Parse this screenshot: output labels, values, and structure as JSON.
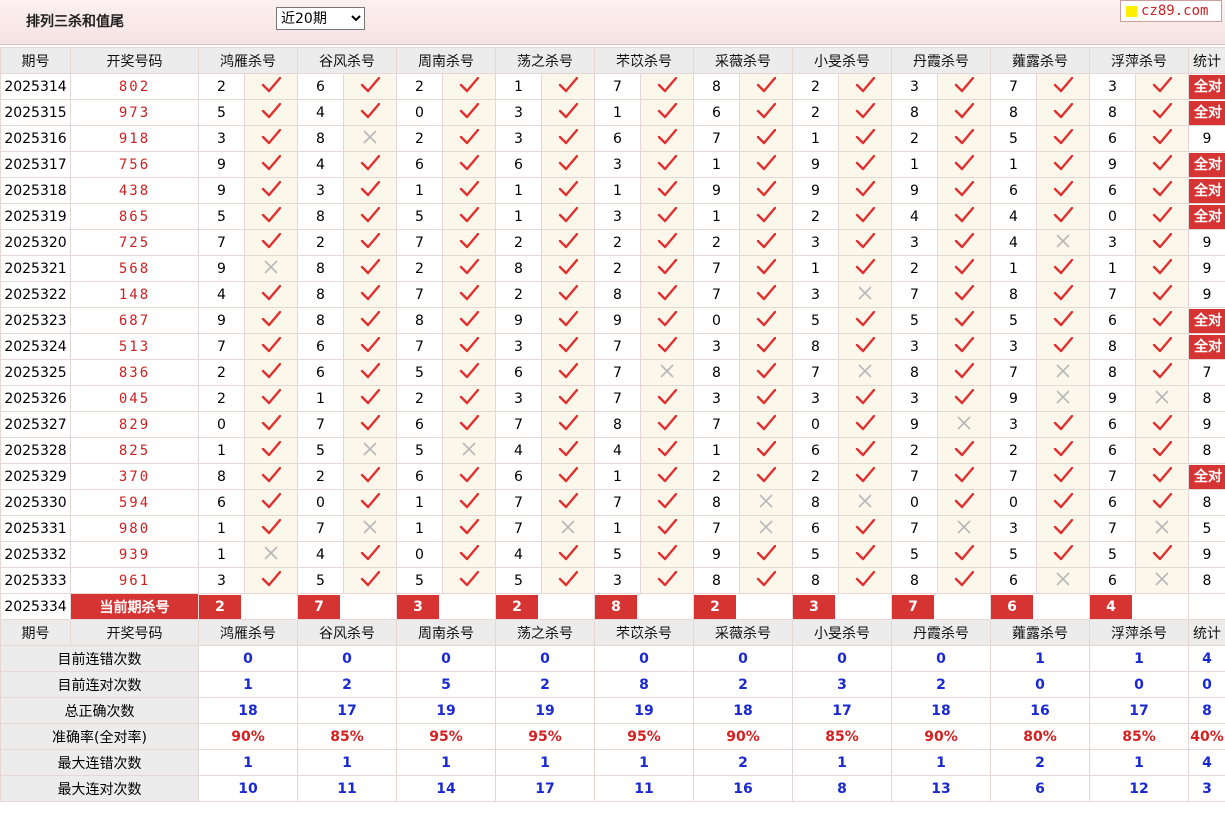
{
  "header": {
    "title": "排列三杀和值尾",
    "period_select": "近20期",
    "logo_text": "cz89.com"
  },
  "columns": {
    "issue": "期号",
    "draw": "开奖号码",
    "experts": [
      "鸿雁杀号",
      "谷风杀号",
      "周南杀号",
      "荡之杀号",
      "芣苡杀号",
      "采薇杀号",
      "小旻杀号",
      "丹霞杀号",
      "蕹露杀号",
      "浮萍杀号"
    ],
    "stat": "统计"
  },
  "rows": [
    {
      "issue": "2025314",
      "draw": "802",
      "kills": [
        2,
        6,
        2,
        1,
        7,
        8,
        2,
        3,
        7,
        3
      ],
      "ok": [
        1,
        1,
        1,
        1,
        1,
        1,
        1,
        1,
        1,
        1
      ],
      "stat": "全对"
    },
    {
      "issue": "2025315",
      "draw": "973",
      "kills": [
        5,
        4,
        0,
        3,
        1,
        6,
        2,
        8,
        8,
        8
      ],
      "ok": [
        1,
        1,
        1,
        1,
        1,
        1,
        1,
        1,
        1,
        1
      ],
      "stat": "全对"
    },
    {
      "issue": "2025316",
      "draw": "918",
      "kills": [
        3,
        8,
        2,
        3,
        6,
        7,
        1,
        2,
        5,
        6
      ],
      "ok": [
        1,
        0,
        1,
        1,
        1,
        1,
        1,
        1,
        1,
        1
      ],
      "stat": "9"
    },
    {
      "issue": "2025317",
      "draw": "756",
      "kills": [
        9,
        4,
        6,
        6,
        3,
        1,
        9,
        1,
        1,
        9
      ],
      "ok": [
        1,
        1,
        1,
        1,
        1,
        1,
        1,
        1,
        1,
        1
      ],
      "stat": "全对"
    },
    {
      "issue": "2025318",
      "draw": "438",
      "kills": [
        9,
        3,
        1,
        1,
        1,
        9,
        9,
        9,
        6,
        6
      ],
      "ok": [
        1,
        1,
        1,
        1,
        1,
        1,
        1,
        1,
        1,
        1
      ],
      "stat": "全对"
    },
    {
      "issue": "2025319",
      "draw": "865",
      "kills": [
        5,
        8,
        5,
        1,
        3,
        1,
        2,
        4,
        4,
        0
      ],
      "ok": [
        1,
        1,
        1,
        1,
        1,
        1,
        1,
        1,
        1,
        1
      ],
      "stat": "全对"
    },
    {
      "issue": "2025320",
      "draw": "725",
      "kills": [
        7,
        2,
        7,
        2,
        2,
        2,
        3,
        3,
        4,
        3
      ],
      "ok": [
        1,
        1,
        1,
        1,
        1,
        1,
        1,
        1,
        0,
        1
      ],
      "stat": "9"
    },
    {
      "issue": "2025321",
      "draw": "568",
      "kills": [
        9,
        8,
        2,
        8,
        2,
        7,
        1,
        2,
        1,
        1
      ],
      "ok": [
        0,
        1,
        1,
        1,
        1,
        1,
        1,
        1,
        1,
        1
      ],
      "stat": "9"
    },
    {
      "issue": "2025322",
      "draw": "148",
      "kills": [
        4,
        8,
        7,
        2,
        8,
        7,
        3,
        7,
        8,
        7
      ],
      "ok": [
        1,
        1,
        1,
        1,
        1,
        1,
        0,
        1,
        1,
        1
      ],
      "stat": "9"
    },
    {
      "issue": "2025323",
      "draw": "687",
      "kills": [
        9,
        8,
        8,
        9,
        9,
        0,
        5,
        5,
        5,
        6
      ],
      "ok": [
        1,
        1,
        1,
        1,
        1,
        1,
        1,
        1,
        1,
        1
      ],
      "stat": "全对"
    },
    {
      "issue": "2025324",
      "draw": "513",
      "kills": [
        7,
        6,
        7,
        3,
        7,
        3,
        8,
        3,
        3,
        8
      ],
      "ok": [
        1,
        1,
        1,
        1,
        1,
        1,
        1,
        1,
        1,
        1
      ],
      "stat": "全对"
    },
    {
      "issue": "2025325",
      "draw": "836",
      "kills": [
        2,
        6,
        5,
        6,
        7,
        8,
        7,
        8,
        7,
        8
      ],
      "ok": [
        1,
        1,
        1,
        1,
        0,
        1,
        0,
        1,
        0,
        1
      ],
      "stat": "7"
    },
    {
      "issue": "2025326",
      "draw": "045",
      "kills": [
        2,
        1,
        2,
        3,
        7,
        3,
        3,
        3,
        9,
        9
      ],
      "ok": [
        1,
        1,
        1,
        1,
        1,
        1,
        1,
        1,
        0,
        0
      ],
      "stat": "8"
    },
    {
      "issue": "2025327",
      "draw": "829",
      "kills": [
        0,
        7,
        6,
        7,
        8,
        7,
        0,
        9,
        3,
        6
      ],
      "ok": [
        1,
        1,
        1,
        1,
        1,
        1,
        1,
        0,
        1,
        1
      ],
      "stat": "9"
    },
    {
      "issue": "2025328",
      "draw": "825",
      "kills": [
        1,
        5,
        5,
        4,
        4,
        1,
        6,
        2,
        2,
        6
      ],
      "ok": [
        1,
        0,
        0,
        1,
        1,
        1,
        1,
        1,
        1,
        1
      ],
      "stat": "8"
    },
    {
      "issue": "2025329",
      "draw": "370",
      "kills": [
        8,
        2,
        6,
        6,
        1,
        2,
        2,
        7,
        7,
        7
      ],
      "ok": [
        1,
        1,
        1,
        1,
        1,
        1,
        1,
        1,
        1,
        1
      ],
      "stat": "全对"
    },
    {
      "issue": "2025330",
      "draw": "594",
      "kills": [
        6,
        0,
        1,
        7,
        7,
        8,
        8,
        0,
        0,
        6
      ],
      "ok": [
        1,
        1,
        1,
        1,
        1,
        0,
        0,
        1,
        1,
        1
      ],
      "stat": "8"
    },
    {
      "issue": "2025331",
      "draw": "980",
      "kills": [
        1,
        7,
        1,
        7,
        1,
        7,
        6,
        7,
        3,
        7
      ],
      "ok": [
        1,
        0,
        1,
        0,
        1,
        0,
        1,
        0,
        1,
        0
      ],
      "stat": "5"
    },
    {
      "issue": "2025332",
      "draw": "939",
      "kills": [
        1,
        4,
        0,
        4,
        5,
        9,
        5,
        5,
        5,
        5
      ],
      "ok": [
        0,
        1,
        1,
        1,
        1,
        1,
        1,
        1,
        1,
        1
      ],
      "stat": "9"
    },
    {
      "issue": "2025333",
      "draw": "961",
      "kills": [
        3,
        5,
        5,
        5,
        3,
        8,
        8,
        8,
        6,
        6
      ],
      "ok": [
        1,
        1,
        1,
        1,
        1,
        1,
        1,
        1,
        0,
        0
      ],
      "stat": "8"
    }
  ],
  "current": {
    "issue": "2025334",
    "label": "当前期杀号",
    "kills": [
      2,
      7,
      3,
      2,
      8,
      2,
      3,
      7,
      6,
      4
    ]
  },
  "summary": [
    {
      "label": "目前连错次数",
      "values": [
        "0",
        "0",
        "0",
        "0",
        "0",
        "0",
        "0",
        "0",
        "1",
        "1"
      ],
      "stat": "4",
      "stat_red": false,
      "red": false
    },
    {
      "label": "目前连对次数",
      "values": [
        "1",
        "2",
        "5",
        "2",
        "8",
        "2",
        "3",
        "2",
        "0",
        "0"
      ],
      "stat": "0",
      "stat_red": false,
      "red": false
    },
    {
      "label": "总正确次数",
      "values": [
        "18",
        "17",
        "19",
        "19",
        "19",
        "18",
        "17",
        "18",
        "16",
        "17"
      ],
      "stat": "8",
      "stat_red": false,
      "red": false
    },
    {
      "label": "准确率(全对率)",
      "values": [
        "90%",
        "85%",
        "95%",
        "95%",
        "95%",
        "90%",
        "85%",
        "90%",
        "80%",
        "85%"
      ],
      "stat": "40%",
      "stat_red": true,
      "red": true
    },
    {
      "label": "最大连错次数",
      "values": [
        "1",
        "1",
        "1",
        "1",
        "1",
        "2",
        "1",
        "1",
        "2",
        "1"
      ],
      "stat": "4",
      "stat_red": false,
      "red": false
    },
    {
      "label": "最大连对次数",
      "values": [
        "10",
        "11",
        "14",
        "17",
        "11",
        "16",
        "8",
        "13",
        "6",
        "12"
      ],
      "stat": "3",
      "stat_red": false,
      "red": false
    }
  ]
}
